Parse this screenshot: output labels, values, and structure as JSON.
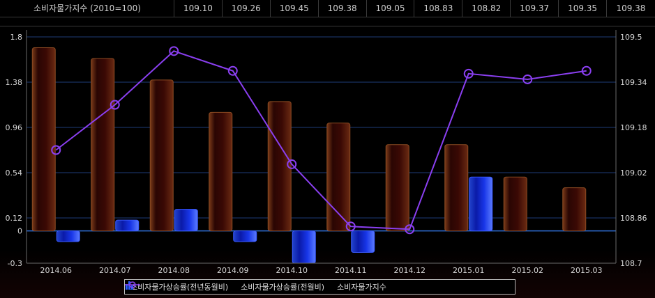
{
  "table": {
    "label": "소비자물가지수 (2010=100)",
    "values": [
      "109.10",
      "109.26",
      "109.45",
      "109.38",
      "109.05",
      "108.83",
      "108.82",
      "109.37",
      "109.35",
      "109.38"
    ]
  },
  "legend": {
    "series1": "소비자물가상승률(전년동월비)",
    "series2": "소비자물가상승률(전월비)",
    "series3": "소비자물가지수"
  },
  "chart_data": {
    "type": "bar",
    "categories": [
      "2014.06",
      "2014.07",
      "2014.08",
      "2014.09",
      "2014.10",
      "2014.11",
      "2014.12",
      "2015.01",
      "2015.02",
      "2015.03"
    ],
    "series": [
      {
        "name": "소비자물가상승률(전년동월비)",
        "type": "bar",
        "axis": "left",
        "color": "#3a0c06",
        "values": [
          1.7,
          1.6,
          1.4,
          1.1,
          1.2,
          1.0,
          0.8,
          0.8,
          0.5,
          0.4
        ]
      },
      {
        "name": "소비자물가상승률(전월비)",
        "type": "bar",
        "axis": "left",
        "color": "#1f3fe0",
        "values": [
          -0.1,
          0.1,
          0.2,
          -0.1,
          -0.3,
          -0.2,
          0.0,
          0.5,
          0.0,
          0.0
        ]
      },
      {
        "name": "소비자물가지수",
        "type": "line",
        "axis": "right",
        "color": "#8a3ff0",
        "values": [
          109.1,
          109.26,
          109.45,
          109.38,
          109.05,
          108.83,
          108.82,
          109.37,
          109.35,
          109.38
        ]
      }
    ],
    "y_left": {
      "min": -0.3,
      "max": 1.8,
      "ticks": [
        "1.8",
        "1.38",
        "0.96",
        "0.54",
        "0.12",
        "0",
        "-0.3"
      ]
    },
    "y_right": {
      "min": 108.7,
      "max": 109.5,
      "ticks": [
        "109.5",
        "109.34",
        "109.18",
        "109.02",
        "108.86",
        "108.7"
      ]
    },
    "grid": true,
    "legend_position": "bottom"
  }
}
